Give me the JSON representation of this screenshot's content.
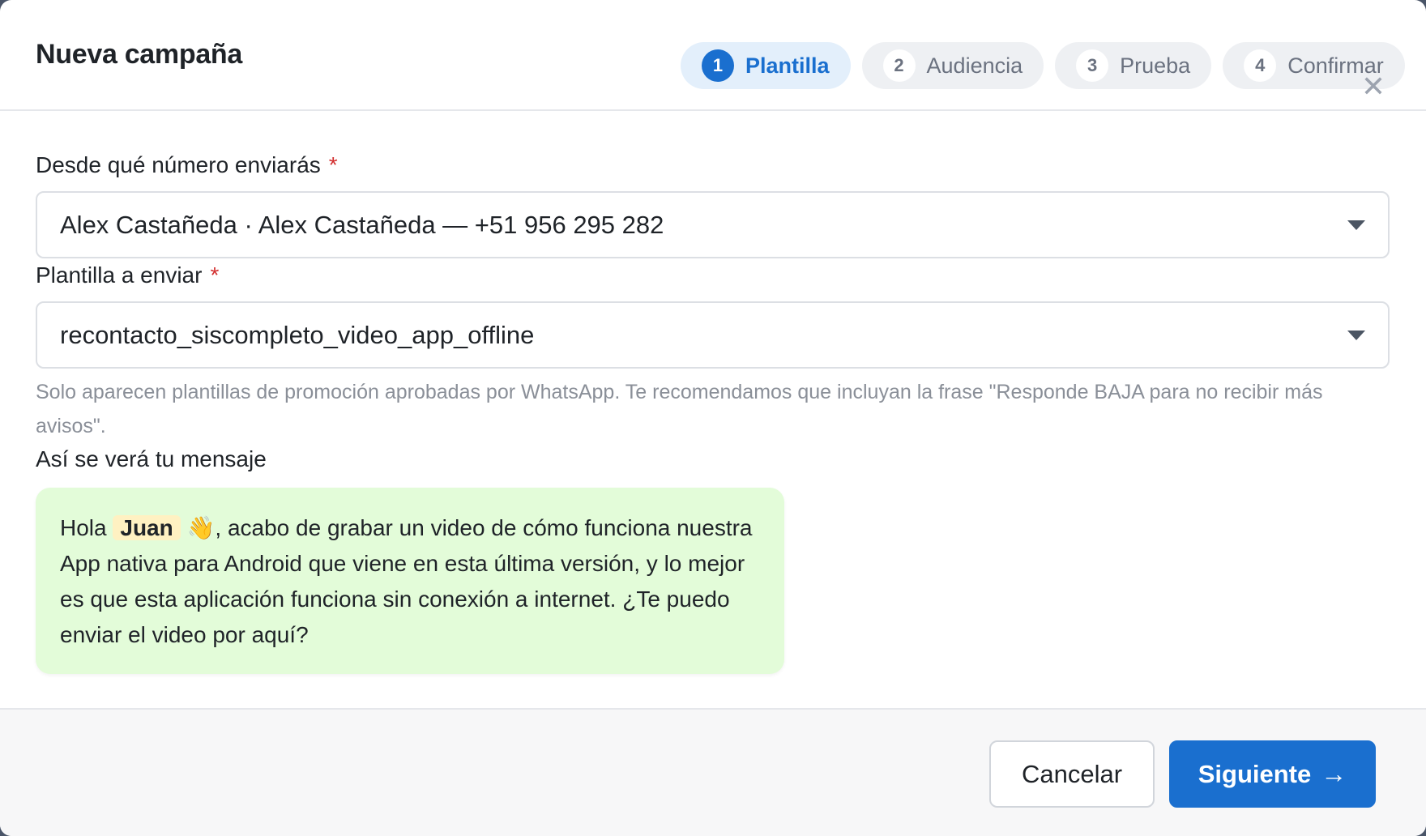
{
  "header": {
    "title": "Nueva campaña",
    "close_symbol": "✕",
    "steps": [
      {
        "num": "1",
        "label": "Plantilla",
        "active": true
      },
      {
        "num": "2",
        "label": "Audiencia",
        "active": false
      },
      {
        "num": "3",
        "label": "Prueba",
        "active": false
      },
      {
        "num": "4",
        "label": "Confirmar",
        "active": false
      }
    ]
  },
  "form": {
    "sender": {
      "label": "Desde qué número enviarás",
      "required_mark": "*",
      "value": "Alex Castañeda · Alex Castañeda — +51 956 295 282"
    },
    "template": {
      "label": "Plantilla a enviar",
      "required_mark": "*",
      "value": "recontacto_siscompleto_video_app_offline",
      "hint": "Solo aparecen plantillas de promoción aprobadas por WhatsApp. Te recomendamos que incluyan la frase \"Responde BAJA para no recibir más avisos\"."
    },
    "preview": {
      "label": "Así se verá tu mensaje",
      "greeting": "Hola",
      "variable": "Juan",
      "emoji": "👋",
      "body": ", acabo de grabar un video de cómo funciona nuestra App nativa para Android que viene en esta última versión, y lo mejor es que esta aplicación funciona sin conexión a internet. ¿Te puedo enviar el video por aquí?"
    }
  },
  "footer": {
    "cancel_label": "Cancelar",
    "next_label": "Siguiente",
    "next_arrow": "→"
  },
  "colors": {
    "accent": "#1a6fcf",
    "bubble": "#e3fcd9",
    "variable_chip": "#fff1c2",
    "required": "#d32f2f"
  }
}
